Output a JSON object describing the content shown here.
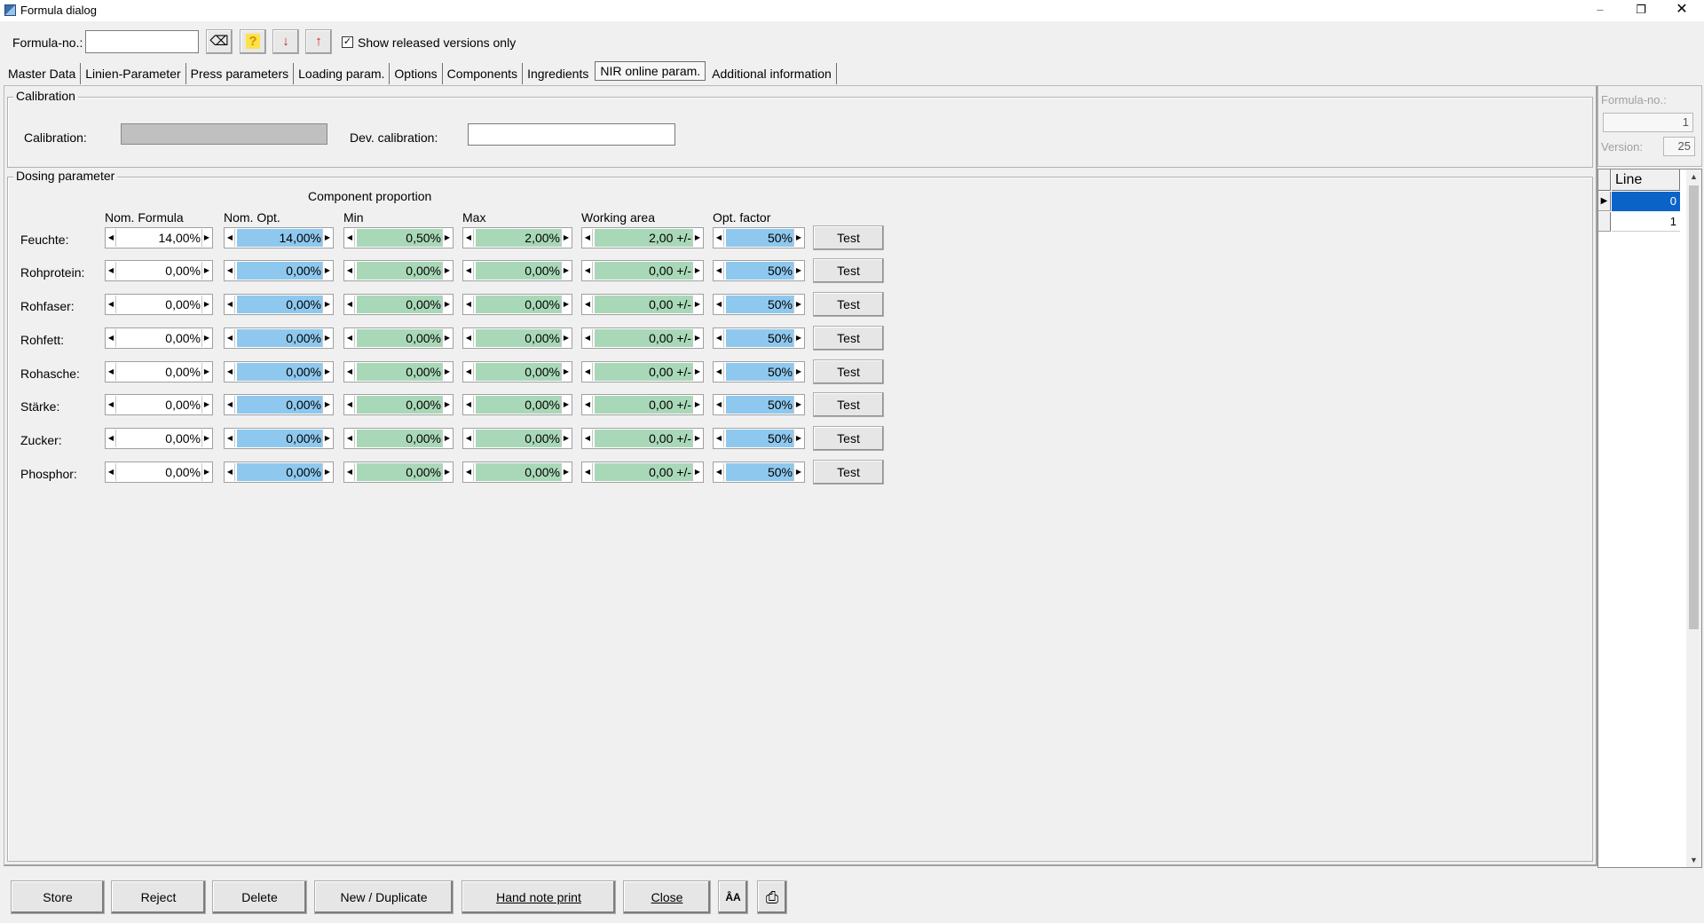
{
  "window": {
    "title": "Formula dialog",
    "min": "–",
    "restore": "❐",
    "close": "✕"
  },
  "toolbar": {
    "formula_label": "Formula-no.:",
    "formula_value": "",
    "show_released_label": "Show released versions only",
    "show_released_checked": "✓",
    "eraser_icon": "⌫",
    "help_icon": "?",
    "down_icon": "↓",
    "up_icon": "↑"
  },
  "tabs": [
    "Master Data",
    "Linien-Parameter",
    "Press parameters",
    "Loading param.",
    "Options",
    "Components",
    "Ingredients",
    "NIR online param.",
    "Additional information"
  ],
  "calibration": {
    "group_title": "Calibration",
    "calibration_label": "Calibration:",
    "dev_label": "Dev. calibration:",
    "dev_value": ""
  },
  "dosing": {
    "group_title": "Dosing parameter",
    "component_proportion": "Component proportion",
    "headers": {
      "nom_formula": "Nom. Formula",
      "nom_opt": "Nom. Opt.",
      "min": "Min",
      "max": "Max",
      "working_area": "Working area",
      "opt_factor": "Opt. factor"
    },
    "test_label": "Test",
    "rows": [
      {
        "name": "Feuchte:",
        "nom_formula": "14,00%",
        "nom_opt": "14,00%",
        "min": "0,50%",
        "max": "2,00%",
        "working": "2,00 +/-",
        "opt": "50%"
      },
      {
        "name": "Rohprotein:",
        "nom_formula": "0,00%",
        "nom_opt": "0,00%",
        "min": "0,00%",
        "max": "0,00%",
        "working": "0,00 +/-",
        "opt": "50%"
      },
      {
        "name": "Rohfaser:",
        "nom_formula": "0,00%",
        "nom_opt": "0,00%",
        "min": "0,00%",
        "max": "0,00%",
        "working": "0,00 +/-",
        "opt": "50%"
      },
      {
        "name": "Rohfett:",
        "nom_formula": "0,00%",
        "nom_opt": "0,00%",
        "min": "0,00%",
        "max": "0,00%",
        "working": "0,00 +/-",
        "opt": "50%"
      },
      {
        "name": "Rohasche:",
        "nom_formula": "0,00%",
        "nom_opt": "0,00%",
        "min": "0,00%",
        "max": "0,00%",
        "working": "0,00 +/-",
        "opt": "50%"
      },
      {
        "name": "Stärke:",
        "nom_formula": "0,00%",
        "nom_opt": "0,00%",
        "min": "0,00%",
        "max": "0,00%",
        "working": "0,00 +/-",
        "opt": "50%"
      },
      {
        "name": "Zucker:",
        "nom_formula": "0,00%",
        "nom_opt": "0,00%",
        "min": "0,00%",
        "max": "0,00%",
        "working": "0,00 +/-",
        "opt": "50%"
      },
      {
        "name": "Phosphor:",
        "nom_formula": "0,00%",
        "nom_opt": "0,00%",
        "min": "0,00%",
        "max": "0,00%",
        "working": "0,00 +/-",
        "opt": "50%"
      }
    ]
  },
  "side": {
    "formula_label": "Formula-no.:",
    "formula_value": "1",
    "version_label": "Version:",
    "version_value": "25",
    "grid_header": "Line",
    "lines": [
      "0",
      "1"
    ]
  },
  "bottom": {
    "store": "Store",
    "reject": "Reject",
    "delete": "Delete",
    "new_duplicate": "New / Duplicate",
    "hand_note_print": "Hand note print",
    "close": "Close",
    "font_icon": "ÂA",
    "print_icon": "⎙"
  },
  "colors": {
    "nom_opt_fill": "#8ec8ee",
    "range_fill": "#a9d8b8",
    "selected_row": "#0a64c8"
  }
}
